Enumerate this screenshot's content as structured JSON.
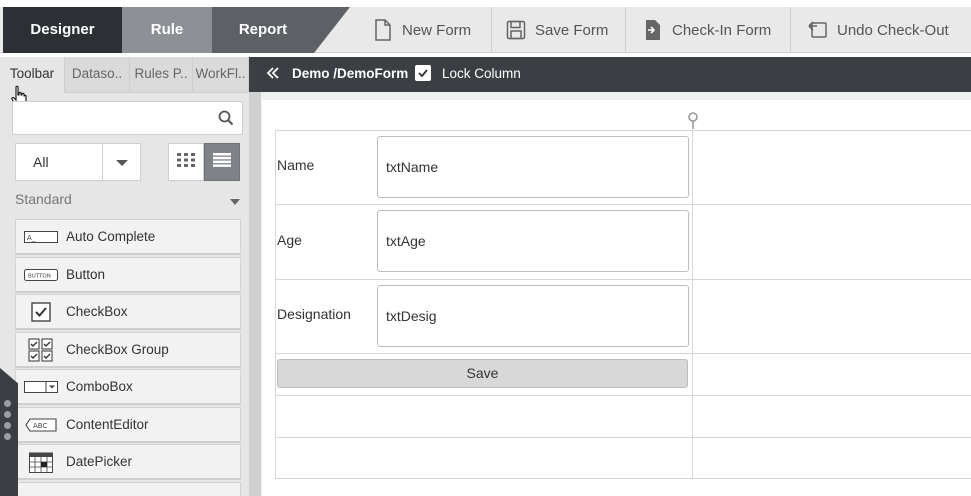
{
  "modes": {
    "designer": "Designer",
    "rule": "Rule",
    "report": "Report"
  },
  "toolbar": {
    "new_form": {
      "label": "New Form",
      "icon": "new-document-icon"
    },
    "save_form": {
      "label": "Save Form",
      "icon": "floppy-disk-icon"
    },
    "check_in": {
      "label": "Check-In Form",
      "icon": "check-in-icon"
    },
    "undo_checkout": {
      "label": "Undo Check-Out",
      "icon": "undo-icon"
    }
  },
  "left_panel": {
    "tabs": [
      "Toolbar",
      "Dataso..",
      "Rules P..",
      "WorkFl.."
    ],
    "active_tab": "Toolbar",
    "search": {
      "placeholder": "",
      "value": ""
    },
    "filter": {
      "selected": "All"
    },
    "section": "Standard",
    "controls": [
      {
        "label": "Auto Complete",
        "icon": "autocomplete-icon"
      },
      {
        "label": "Button",
        "icon": "button-icon"
      },
      {
        "label": "CheckBox",
        "icon": "checkbox-icon"
      },
      {
        "label": "CheckBox Group",
        "icon": "checkbox-group-icon"
      },
      {
        "label": "ComboBox",
        "icon": "combobox-icon"
      },
      {
        "label": "ContentEditor",
        "icon": "content-editor-icon"
      },
      {
        "label": "DatePicker",
        "icon": "datepicker-icon"
      }
    ]
  },
  "form_header": {
    "breadcrumb": "Demo /DemoForm",
    "lock_column_label": "Lock Column",
    "lock_column_checked": true
  },
  "form": {
    "rows": [
      {
        "label": "Name",
        "value": "txtName"
      },
      {
        "label": "Age",
        "value": "txtAge"
      },
      {
        "label": "Designation",
        "value": "txtDesig"
      }
    ],
    "save_label": "Save"
  },
  "colors": {
    "designer_tab": "#2c2f33",
    "rule_tab": "#8d9196",
    "report_tab": "#5d6166",
    "header_bar": "#3b3f44"
  }
}
